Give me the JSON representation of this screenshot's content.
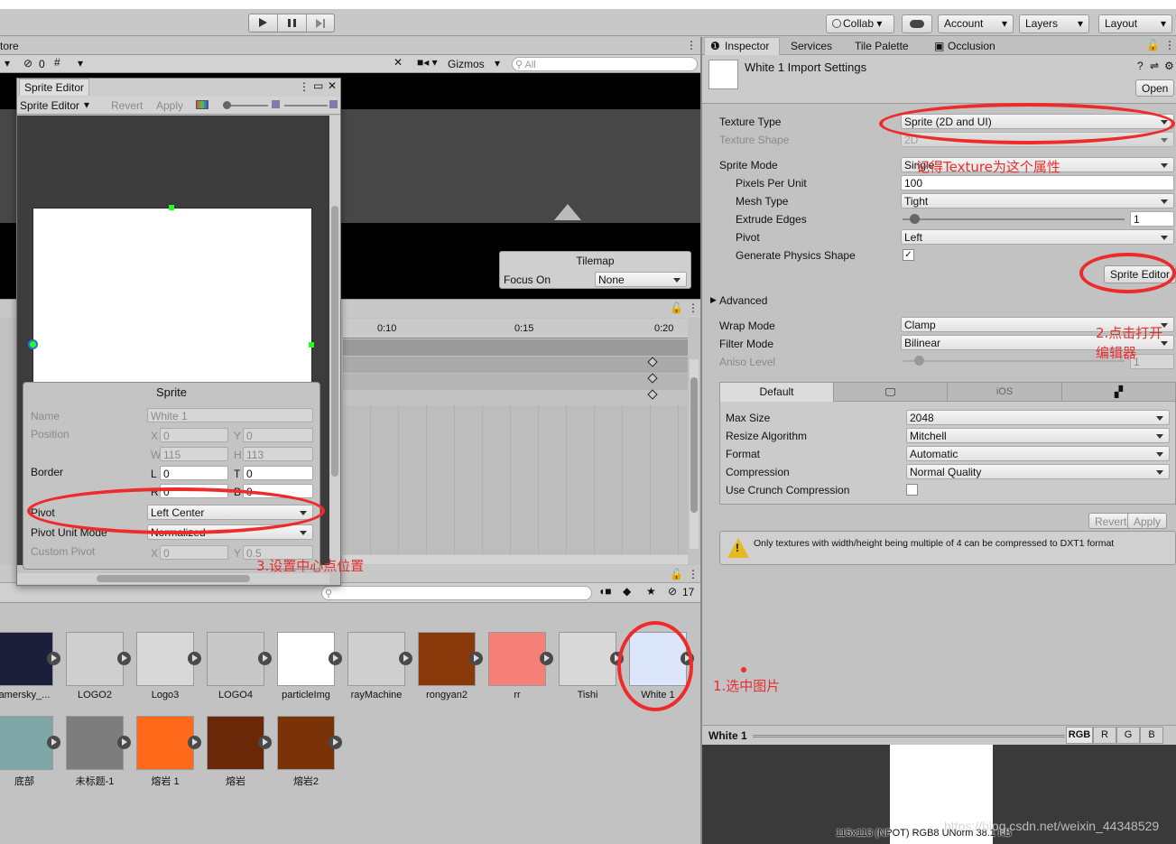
{
  "toolbar": {
    "play_icon": "play-icon",
    "pause_icon": "pause-icon",
    "step_icon": "step-icon",
    "collab": "Collab",
    "cloud_icon": "cloud-icon",
    "account": "Account",
    "layers": "Layers",
    "layout": "Layout"
  },
  "scene": {
    "tab_partial": "tore",
    "hidden_count": "0",
    "gizmos": "Gizmos",
    "search_placeholder": "All",
    "tilemap": {
      "title": "Tilemap",
      "focus_label": "Focus On",
      "focus_value": "None"
    }
  },
  "sprite_editor": {
    "title": "Sprite Editor",
    "mode": "Sprite Editor",
    "revert": "Revert",
    "apply": "Apply",
    "panel_title": "Sprite",
    "name_label": "Name",
    "name_value": "White 1",
    "position_label": "Position",
    "x": "0",
    "y": "0",
    "w": "115",
    "h": "113",
    "border_label": "Border",
    "l": "0",
    "t": "0",
    "r": "0",
    "b": "0",
    "pivot_label": "Pivot",
    "pivot_value": "Left Center",
    "pivot_unit_label": "Pivot Unit Mode",
    "pivot_unit_value": "Normalized",
    "custom_pivot_label": "Custom Pivot",
    "cx": "0",
    "cy": "0.5"
  },
  "animation": {
    "t1": "0:10",
    "t2": "0:15",
    "t3": "0:20"
  },
  "project": {
    "search_placeholder": "",
    "hidden_count": "17",
    "assets_row1": [
      {
        "name": "amersky_...",
        "color": "#1b1f3a"
      },
      {
        "name": "LOGO2",
        "color": "#cfcfcf"
      },
      {
        "name": "Logo3",
        "color": "#d8d8d8"
      },
      {
        "name": "LOGO4",
        "color": "#c8c8c8"
      },
      {
        "name": "particleImg",
        "color": "#ffffff"
      },
      {
        "name": "rayMachine",
        "color": "#cfcfcf"
      },
      {
        "name": "rongyan2",
        "color": "#8a3a0a"
      },
      {
        "name": "rr",
        "color": "#f48077"
      },
      {
        "name": "Tishi",
        "color": "#d8d8d8"
      },
      {
        "name": "White 1",
        "color": "#dbe6fb"
      }
    ],
    "assets_row2": [
      {
        "name": "底部",
        "color": "#7fa7a8"
      },
      {
        "name": "未标题-1",
        "color": "#7d7d7d"
      },
      {
        "name": "熔岩 1",
        "color": "#ff6a1a"
      },
      {
        "name": "熔岩",
        "color": "#6b2808"
      },
      {
        "name": "熔岩2",
        "color": "#7a3208"
      }
    ]
  },
  "inspector": {
    "tabs": [
      "Inspector",
      "Services",
      "Tile Palette",
      "Occlusion"
    ],
    "header_title": "White 1 Import Settings",
    "open_button": "Open",
    "texture_type_label": "Texture Type",
    "texture_type_value": "Sprite (2D and UI)",
    "texture_shape_label": "Texture Shape",
    "texture_shape_value": "2D",
    "sprite_mode_label": "Sprite Mode",
    "sprite_mode_value": "Single",
    "ppu_label": "Pixels Per Unit",
    "ppu_value": "100",
    "mesh_type_label": "Mesh Type",
    "mesh_type_value": "Tight",
    "extrude_label": "Extrude Edges",
    "extrude_value": "1",
    "pivot_label": "Pivot",
    "pivot_value": "Left",
    "physics_label": "Generate Physics Shape",
    "sprite_editor_button": "Sprite Editor",
    "advanced_label": "Advanced",
    "wrap_label": "Wrap Mode",
    "wrap_value": "Clamp",
    "filter_label": "Filter Mode",
    "filter_value": "Bilinear",
    "aniso_label": "Aniso Level",
    "aniso_value": "1",
    "platform_default": "Default",
    "platform_ios": "iOS",
    "max_size_label": "Max Size",
    "max_size_value": "2048",
    "resize_label": "Resize Algorithm",
    "resize_value": "Mitchell",
    "format_label": "Format",
    "format_value": "Automatic",
    "compression_label": "Compression",
    "compression_value": "Normal Quality",
    "crunch_label": "Use Crunch Compression",
    "revert": "Revert",
    "apply": "Apply",
    "warning": "Only textures with width/height being multiple of 4 can be compressed to DXT1 format"
  },
  "preview": {
    "title": "White 1",
    "channels": [
      "RGB",
      "R",
      "G",
      "B"
    ],
    "info": "115x113 (NPOT)  RGB8 UNorm   38.1 KB",
    "watermark": "https://blog.csdn.net/weixin_44348529"
  },
  "annotations": {
    "step1": "1.选中图片",
    "step2_line1": "2.点击打开",
    "step2_line2": "编辑器",
    "step3": "3.设置中心点位置",
    "note": "记得Texture为这个属性",
    "color": "#ee2b2b"
  }
}
